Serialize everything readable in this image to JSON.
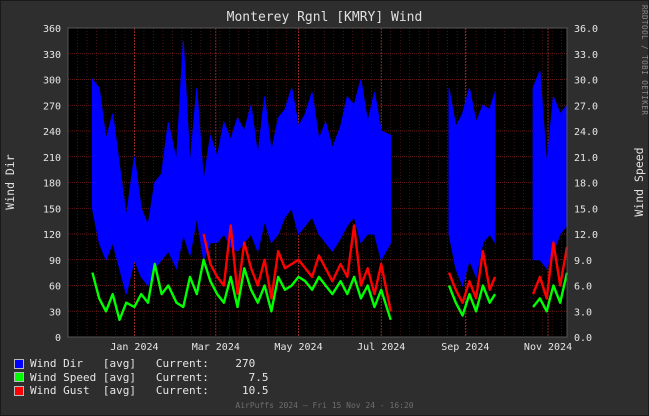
{
  "title": "Monterey Rgnl [KMRY] Wind",
  "watermark": "RRDTOOL / TOBI OETIKER",
  "footer": "AirPuffs 2024 — Fri 15 Nov 24 - 16:20",
  "colors": {
    "background": "#2e2e2e",
    "plot_bg": "#000000",
    "grid": "#7a2020",
    "wind_dir": "#0000ff",
    "wind_speed": "#00ff00",
    "wind_gust": "#ff0000",
    "text": "#e6e6e6"
  },
  "legend": [
    {
      "name": "Wind Dir   [avg]",
      "current_label": "Current:",
      "current": "270",
      "color": "#0000ff"
    },
    {
      "name": "Wind Speed [avg]",
      "current_label": "Current:",
      "current": "7.5",
      "color": "#00ff00"
    },
    {
      "name": "Wind Gust  [avg]",
      "current_label": "Current:",
      "current": "10.5",
      "color": "#ff0000"
    }
  ],
  "chart_data": {
    "type": "area",
    "title": "Monterey Rgnl [KMRY] Wind",
    "ylabel_left": "Wind Dir",
    "ylabel_right": "Wind Speed",
    "ylim_left": [
      0,
      360
    ],
    "ylim_right": [
      0,
      36
    ],
    "left_ticks": [
      "0",
      "30",
      "60",
      "90",
      "120",
      "150",
      "180",
      "210",
      "240",
      "270",
      "300",
      "330",
      "360"
    ],
    "right_ticks": [
      "0.0",
      "3.0",
      "6.0",
      "9.0",
      "12.0",
      "15.0",
      "18.0",
      "21.0",
      "24.0",
      "27.0",
      "30.0",
      "33.0",
      "36.0"
    ],
    "x_ticks": [
      "Jan 2024",
      "Mar 2024",
      "May 2024",
      "Jul 2024",
      "Sep 2024",
      "Nov 2024"
    ],
    "x_tick_dates": [
      "2024-01-01",
      "2024-03-01",
      "2024-05-01",
      "2024-07-01",
      "2024-09-01",
      "2024-11-01"
    ],
    "xlim": [
      "2023-11-13",
      "2024-11-15"
    ],
    "grid": true,
    "legend_position": "bottom-left",
    "data_segments": [
      {
        "start": "2023-12-01",
        "end": "2024-07-08"
      },
      {
        "start": "2024-08-20",
        "end": "2024-09-23"
      },
      {
        "start": "2024-10-21",
        "end": "2024-11-15"
      }
    ],
    "series": [
      {
        "name": "Wind Dir",
        "axis": "left",
        "style": "area",
        "color": "#0000ff",
        "x": [
          "2023-12-01",
          "2023-12-06",
          "2023-12-11",
          "2023-12-16",
          "2023-12-21",
          "2023-12-26",
          "2024-01-01",
          "2024-01-06",
          "2024-01-11",
          "2024-01-16",
          "2024-01-21",
          "2024-01-26",
          "2024-02-01",
          "2024-02-06",
          "2024-02-11",
          "2024-02-16",
          "2024-02-21",
          "2024-02-26",
          "2024-03-02",
          "2024-03-07",
          "2024-03-12",
          "2024-03-17",
          "2024-03-22",
          "2024-03-27",
          "2024-04-01",
          "2024-04-06",
          "2024-04-11",
          "2024-04-16",
          "2024-04-21",
          "2024-04-26",
          "2024-05-01",
          "2024-05-06",
          "2024-05-11",
          "2024-05-16",
          "2024-05-21",
          "2024-05-26",
          "2024-06-01",
          "2024-06-06",
          "2024-06-11",
          "2024-06-16",
          "2024-06-21",
          "2024-06-26",
          "2024-07-01",
          "2024-07-08",
          "2024-08-20",
          "2024-08-25",
          "2024-08-30",
          "2024-09-04",
          "2024-09-09",
          "2024-09-14",
          "2024-09-19",
          "2024-09-23",
          "2024-10-21",
          "2024-10-26",
          "2024-10-31",
          "2024-11-05",
          "2024-11-10",
          "2024-11-15"
        ],
        "y_top": [
          300,
          290,
          230,
          260,
          200,
          140,
          210,
          150,
          130,
          180,
          190,
          250,
          205,
          345,
          200,
          290,
          180,
          235,
          210,
          250,
          230,
          255,
          240,
          270,
          210,
          280,
          215,
          255,
          265,
          290,
          245,
          260,
          285,
          230,
          250,
          220,
          245,
          280,
          270,
          300,
          250,
          285,
          240,
          235,
          290,
          245,
          260,
          290,
          250,
          270,
          265,
          285,
          290,
          310,
          200,
          280,
          260,
          270
        ],
        "y_bottom": [
          150,
          110,
          90,
          110,
          80,
          50,
          90,
          70,
          60,
          80,
          90,
          100,
          80,
          120,
          95,
          140,
          90,
          110,
          110,
          120,
          105,
          100,
          110,
          120,
          100,
          135,
          110,
          120,
          140,
          150,
          120,
          130,
          140,
          120,
          110,
          100,
          115,
          130,
          140,
          110,
          120,
          120,
          90,
          110,
          120,
          80,
          60,
          90,
          70,
          110,
          120,
          110,
          90,
          90,
          80,
          100,
          120,
          130
        ]
      },
      {
        "name": "Wind Speed",
        "axis": "right",
        "style": "line",
        "color": "#00ff00",
        "x": [
          "2023-12-01",
          "2023-12-06",
          "2023-12-11",
          "2023-12-16",
          "2023-12-21",
          "2023-12-26",
          "2024-01-01",
          "2024-01-06",
          "2024-01-11",
          "2024-01-16",
          "2024-01-21",
          "2024-01-26",
          "2024-02-01",
          "2024-02-06",
          "2024-02-11",
          "2024-02-16",
          "2024-02-21",
          "2024-02-26",
          "2024-03-02",
          "2024-03-07",
          "2024-03-12",
          "2024-03-17",
          "2024-03-22",
          "2024-03-27",
          "2024-04-01",
          "2024-04-06",
          "2024-04-11",
          "2024-04-16",
          "2024-04-21",
          "2024-04-26",
          "2024-05-01",
          "2024-05-06",
          "2024-05-11",
          "2024-05-16",
          "2024-05-21",
          "2024-05-26",
          "2024-06-01",
          "2024-06-06",
          "2024-06-11",
          "2024-06-16",
          "2024-06-21",
          "2024-06-26",
          "2024-07-01",
          "2024-07-08",
          "2024-08-20",
          "2024-08-25",
          "2024-08-30",
          "2024-09-04",
          "2024-09-09",
          "2024-09-14",
          "2024-09-19",
          "2024-09-23",
          "2024-10-21",
          "2024-10-26",
          "2024-10-31",
          "2024-11-05",
          "2024-11-10",
          "2024-11-15"
        ],
        "y": [
          7.5,
          4.5,
          3.0,
          5.0,
          2.0,
          4.0,
          3.5,
          5.0,
          4.0,
          8.5,
          5.0,
          6.0,
          4.0,
          3.5,
          7.0,
          5.0,
          9.0,
          6.5,
          5.0,
          4.0,
          7.0,
          3.5,
          8.0,
          5.5,
          4.0,
          6.0,
          3.0,
          7.0,
          5.5,
          6.0,
          7.0,
          6.5,
          5.5,
          7.0,
          6.0,
          5.0,
          6.5,
          5.0,
          7.0,
          4.5,
          6.0,
          3.5,
          5.5,
          2.0,
          6.0,
          4.0,
          2.5,
          5.0,
          3.0,
          6.0,
          4.0,
          5.0,
          3.5,
          4.5,
          3.0,
          6.0,
          4.0,
          7.5
        ]
      },
      {
        "name": "Wind Gust",
        "axis": "right",
        "style": "line",
        "color": "#ff0000",
        "x": [
          "2024-02-21",
          "2024-02-26",
          "2024-03-02",
          "2024-03-07",
          "2024-03-12",
          "2024-03-17",
          "2024-03-22",
          "2024-03-27",
          "2024-04-01",
          "2024-04-06",
          "2024-04-11",
          "2024-04-16",
          "2024-04-21",
          "2024-04-26",
          "2024-05-01",
          "2024-05-06",
          "2024-05-11",
          "2024-05-16",
          "2024-05-21",
          "2024-05-26",
          "2024-06-01",
          "2024-06-06",
          "2024-06-11",
          "2024-06-16",
          "2024-06-21",
          "2024-06-26",
          "2024-07-01",
          "2024-07-08",
          "2024-08-20",
          "2024-08-25",
          "2024-08-30",
          "2024-09-04",
          "2024-09-09",
          "2024-09-14",
          "2024-09-19",
          "2024-09-23",
          "2024-10-21",
          "2024-10-26",
          "2024-10-31",
          "2024-11-05",
          "2024-11-10",
          "2024-11-15"
        ],
        "y": [
          12.0,
          8.5,
          7.0,
          6.0,
          13.0,
          5.0,
          11.0,
          8.0,
          6.0,
          9.0,
          4.5,
          10.0,
          8.0,
          8.5,
          9.0,
          8.0,
          7.0,
          9.5,
          8.0,
          6.5,
          8.5,
          7.0,
          13.0,
          6.0,
          8.0,
          5.0,
          8.5,
          3.0,
          7.5,
          5.5,
          4.0,
          6.5,
          4.5,
          10.0,
          5.5,
          7.0,
          5.0,
          7.0,
          4.5,
          11.0,
          6.0,
          10.5
        ]
      }
    ]
  }
}
